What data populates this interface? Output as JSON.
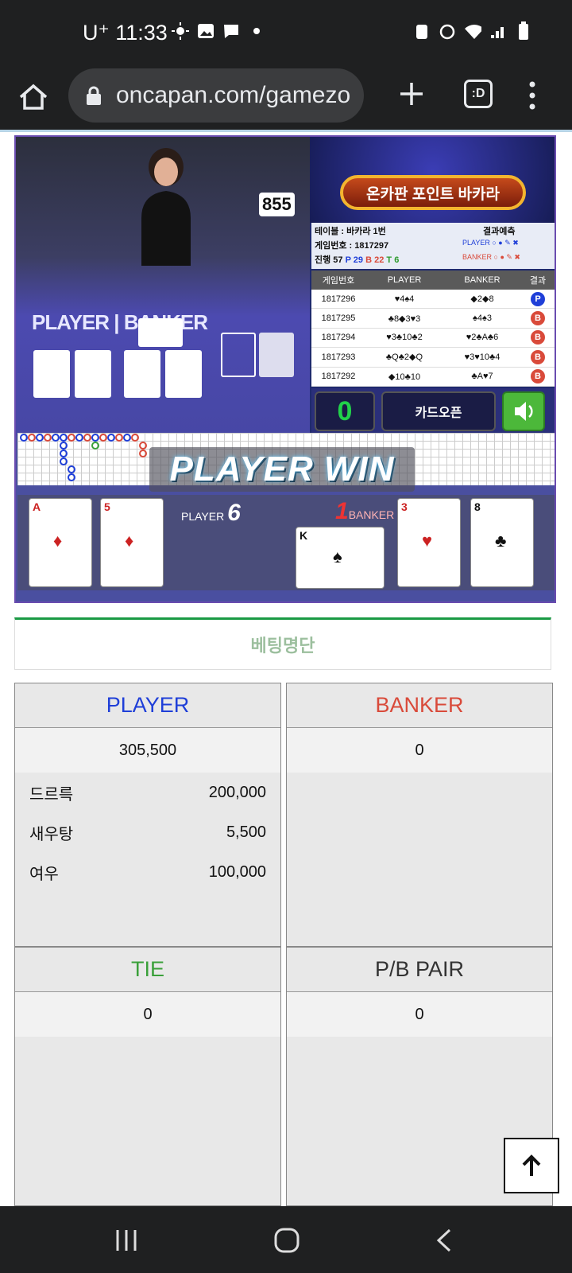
{
  "status": {
    "time": "11:33",
    "carrier": "U⁺"
  },
  "browser": {
    "url": "oncapan.com/gamezo",
    "tabs_label": ":D"
  },
  "game": {
    "table_name": "855",
    "felt": {
      "player": "PLAYER",
      "banker": "BANKER"
    },
    "banner": "온카판 포인트 바카라",
    "info": {
      "table": "테이블 : 바카라 1번",
      "game_no": "게임번호 : 1817297",
      "progress": "진행 57",
      "p": "P 29",
      "b": "B 22",
      "t": "T 6",
      "predict": "결과예측",
      "player": "PLAYER",
      "banker": "BANKER"
    },
    "history": {
      "headers": [
        "게임번호",
        "PLAYER",
        "BANKER",
        "결과"
      ],
      "rows": [
        {
          "no": "1817296",
          "player": "♥4♠4",
          "banker": "◆2◆8",
          "result": "P"
        },
        {
          "no": "1817295",
          "player": "♣8◆3♥3",
          "banker": "♠4♠3",
          "result": "B"
        },
        {
          "no": "1817294",
          "player": "♥3♣10♣2",
          "banker": "♥2♣A♣6",
          "result": "B"
        },
        {
          "no": "1817293",
          "player": "♣Q♣2◆Q",
          "banker": "♥3♥10♣4",
          "result": "B"
        },
        {
          "no": "1817292",
          "player": "◆10♣10",
          "banker": "♣A♥7",
          "result": "B"
        }
      ]
    },
    "count": "0",
    "card_open": "카드오픈",
    "win_text": "PLAYER WIN",
    "player_label": "PLAYER",
    "player_score": "6",
    "banker_label": "BANKER",
    "banker_score": "1",
    "player_cards": [
      {
        "rank": "A",
        "suit": "♦"
      },
      {
        "rank": "5",
        "suit": "♦"
      }
    ],
    "banker_cards": [
      {
        "rank": "K",
        "suit": "♠"
      },
      {
        "rank": "3",
        "suit": "♥"
      },
      {
        "rank": "8",
        "suit": "♣"
      }
    ]
  },
  "betting": {
    "title": "베팅명단",
    "player": {
      "label": "PLAYER",
      "total": "305,500",
      "items": [
        {
          "name": "드르륵",
          "amount": "200,000"
        },
        {
          "name": "새우탕",
          "amount": "5,500"
        },
        {
          "name": "여우",
          "amount": "100,000"
        }
      ]
    },
    "banker": {
      "label": "BANKER",
      "total": "0"
    },
    "tie": {
      "label": "TIE",
      "total": "0"
    },
    "pair": {
      "label": "P/B PAIR",
      "total": "0"
    }
  },
  "colors": {
    "player": "#1f3fd8",
    "banker": "#d94a3a",
    "tie": "#3aa03a",
    "pair": "#333333"
  }
}
